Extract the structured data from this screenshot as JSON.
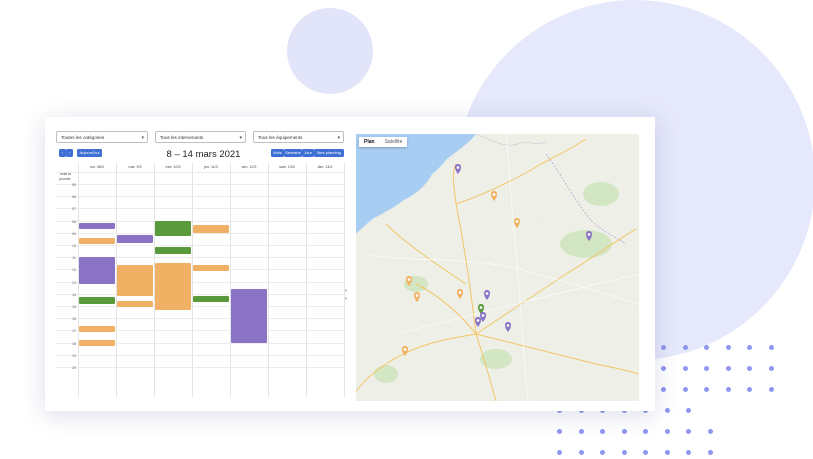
{
  "filters": {
    "categories": "Toutes les catégories",
    "intervenants": "Tous les intervenants",
    "equipements": "Tous les équipements"
  },
  "toolbar": {
    "prev": "‹",
    "next": "›",
    "today": "Aujourd'hui",
    "title": "8 – 14 mars 2021",
    "views": [
      "Mois",
      "Semaine",
      "Jour",
      "Mes planning"
    ]
  },
  "calendar": {
    "days": [
      "lun. 08/3",
      "mar. 9/3",
      "mer. 10/3",
      "jeu. 11/3",
      "ven. 12/3",
      "sam. 13/3",
      "dim. 14/3"
    ],
    "allday_label": "Toute la journée",
    "hours": [
      "05",
      "06",
      "07",
      "08",
      "09",
      "10",
      "11",
      "12",
      "13",
      "14",
      "15",
      "16",
      "17",
      "18",
      "19",
      "20"
    ]
  },
  "map": {
    "tabs": [
      "Plan",
      "Satellite"
    ]
  },
  "colors": {
    "accent": "#3f6fd4",
    "purple": "#8a72c4",
    "orange": "#f1b164",
    "green": "#5a9a3c"
  }
}
